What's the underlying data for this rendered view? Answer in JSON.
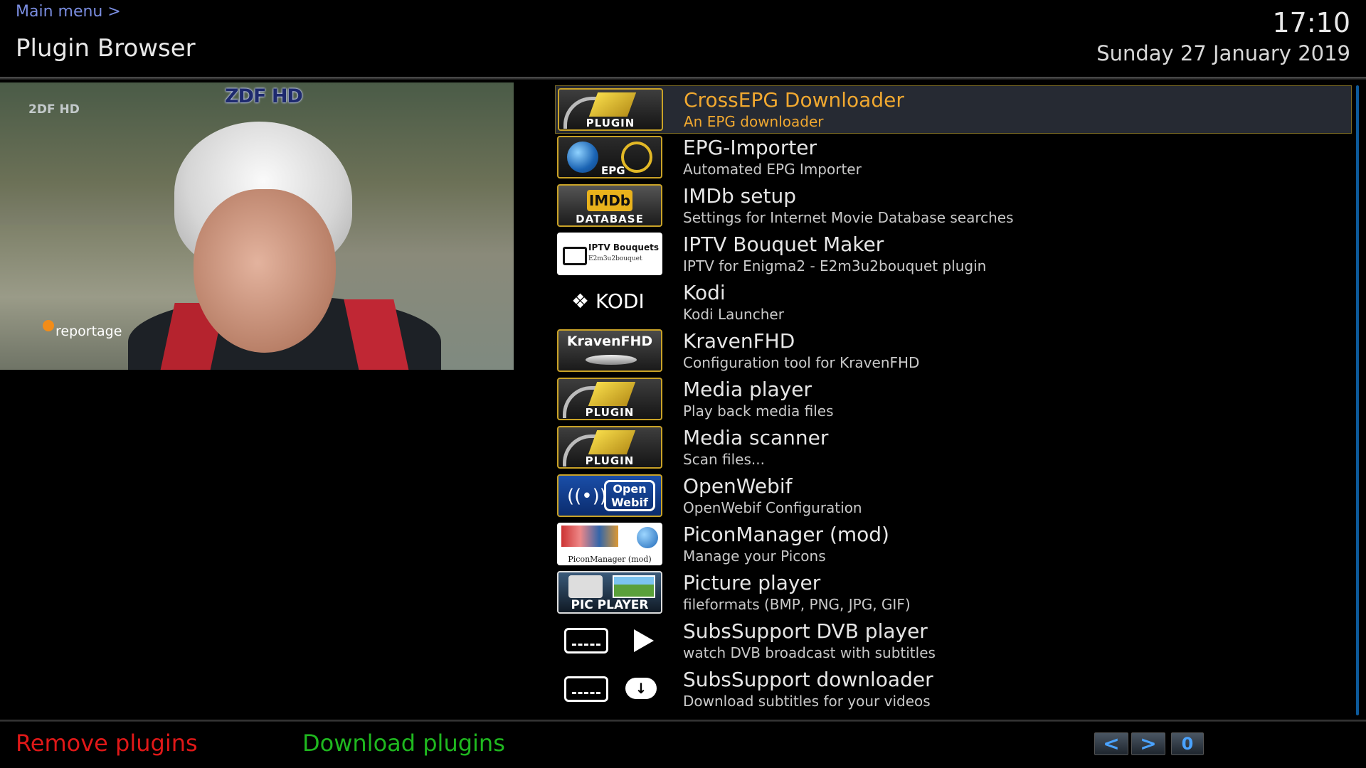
{
  "header": {
    "breadcrumb": "Main menu >",
    "title": "Plugin Browser",
    "time": "17:10",
    "date": "Sunday 27 January 2019"
  },
  "preview": {
    "channel_name": "ZDF HD",
    "channel_logo": "2DF HD",
    "program_logo": "reportage"
  },
  "plugins": [
    {
      "name": "CrossEPG Downloader",
      "description": "An EPG downloader",
      "icon": "plugin-icon",
      "icon_label": "PLUGIN",
      "selected": true
    },
    {
      "name": "EPG-Importer",
      "description": "Automated EPG Importer",
      "icon": "epg-icon",
      "icon_label": "EPG"
    },
    {
      "name": "IMDb setup",
      "description": "Settings for Internet Movie Database searches",
      "icon": "imdb-icon",
      "icon_label": "DATABASE",
      "icon_badge": "IMDb"
    },
    {
      "name": "IPTV Bouquet Maker",
      "description": "IPTV for Enigma2 - E2m3u2bouquet plugin",
      "icon": "iptv-icon",
      "icon_label": "IPTV Bouquets",
      "icon_sublabel": "E2m3u2bouquet"
    },
    {
      "name": "Kodi",
      "description": "Kodi Launcher",
      "icon": "kodi-icon",
      "icon_label": "KODI"
    },
    {
      "name": "KravenFHD",
      "description": "Configuration tool for KravenFHD",
      "icon": "kravenfhd-icon",
      "icon_label": "KravenFHD"
    },
    {
      "name": "Media player",
      "description": "Play back media files",
      "icon": "plugin-icon",
      "icon_label": "PLUGIN"
    },
    {
      "name": "Media scanner",
      "description": "Scan files...",
      "icon": "plugin-icon",
      "icon_label": "PLUGIN"
    },
    {
      "name": "OpenWebif",
      "description": "OpenWebif Configuration",
      "icon": "openwebif-icon",
      "icon_label": "Open Webif"
    },
    {
      "name": "PiconManager (mod)",
      "description": "Manage your Picons",
      "icon": "piconmanager-icon",
      "icon_label": "PiconManager (mod)"
    },
    {
      "name": "Picture player",
      "description": "fileformats (BMP, PNG, JPG, GIF)",
      "icon": "picplayer-icon",
      "icon_label": "PIC PLAYER"
    },
    {
      "name": "SubsSupport DVB player",
      "description": "watch DVB broadcast with subtitles",
      "icon": "subtitle-play-icon"
    },
    {
      "name": "SubsSupport downloader",
      "description": "Download subtitles for your videos",
      "icon": "subtitle-download-icon"
    }
  ],
  "footer": {
    "red_button": "Remove plugins",
    "green_button": "Download plugins",
    "prev_label": "<",
    "next_label": ">",
    "page": "0"
  },
  "colors": {
    "background": "#000000",
    "selected_text": "#f0a830",
    "breadcrumb": "#7a8de0",
    "red": "#e01818",
    "green": "#1fb81f",
    "nav_arrow": "#4aa3ff"
  }
}
